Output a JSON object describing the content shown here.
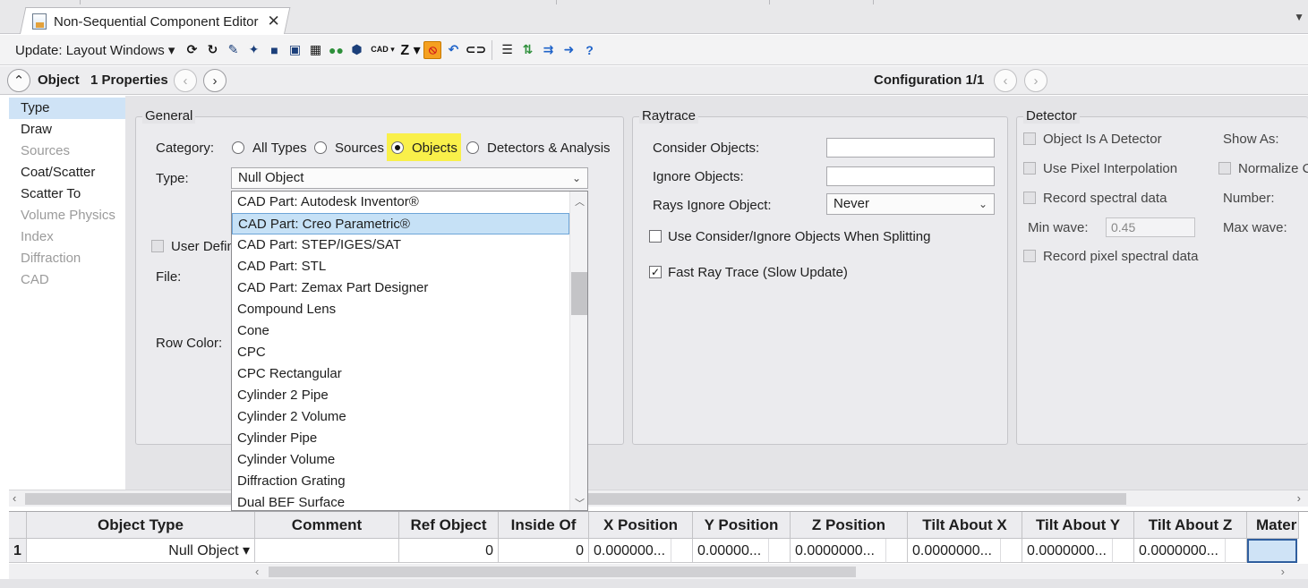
{
  "window": {
    "tab_title": "Non-Sequential Component Editor",
    "close_glyph": "✕"
  },
  "toolbar": {
    "update_label": "Update: Layout Windows ▾",
    "cad_label": "CAD ▾",
    "z_label": "Z ▾"
  },
  "nav": {
    "object_label": "Object",
    "properties_label": "1 Properties",
    "configuration_label": "Configuration 1/1"
  },
  "sidebar": {
    "items": [
      {
        "label": "Type",
        "state": "active"
      },
      {
        "label": "Draw",
        "state": "normal"
      },
      {
        "label": "Sources",
        "state": "disabled"
      },
      {
        "label": "Coat/Scatter",
        "state": "normal"
      },
      {
        "label": "Scatter To",
        "state": "normal"
      },
      {
        "label": "Volume Physics",
        "state": "disabled"
      },
      {
        "label": "Index",
        "state": "disabled"
      },
      {
        "label": "Diffraction",
        "state": "disabled"
      },
      {
        "label": "CAD",
        "state": "disabled"
      }
    ]
  },
  "general": {
    "title": "General",
    "category_label": "Category:",
    "category_options": [
      "All Types",
      "Sources",
      "Objects",
      "Detectors & Analysis"
    ],
    "category_selected": "Objects",
    "type_label": "Type:",
    "type_value": "Null Object",
    "user_defined_label": "User Defin",
    "file_label": "File:",
    "row_color_label": "Row Color:"
  },
  "type_dropdown": {
    "items": [
      "CAD Part: Autodesk Inventor®",
      "CAD Part: Creo Parametric®",
      "CAD Part: STEP/IGES/SAT",
      "CAD Part: STL",
      "CAD Part: Zemax Part Designer",
      "Compound Lens",
      "Cone",
      "CPC",
      "CPC Rectangular",
      "Cylinder 2 Pipe",
      "Cylinder 2 Volume",
      "Cylinder Pipe",
      "Cylinder Volume",
      "Diffraction Grating",
      "Dual BEF Surface"
    ],
    "highlighted": "CAD Part: Creo Parametric®"
  },
  "raytrace": {
    "title": "Raytrace",
    "consider_label": "Consider Objects:",
    "consider_value": "",
    "ignore_label": "Ignore Objects:",
    "ignore_value": "",
    "rays_ignore_label": "Rays Ignore Object:",
    "rays_ignore_value": "Never",
    "use_consider_label": "Use Consider/Ignore Objects When Splitting",
    "use_consider_checked": false,
    "fast_trace_label": "Fast Ray Trace (Slow Update)",
    "fast_trace_checked": true
  },
  "detector": {
    "title": "Detector",
    "is_detector_label": "Object Is A Detector",
    "pixel_interp_label": "Use Pixel Interpolation",
    "record_spectral_label": "Record spectral data",
    "min_wave_label": "Min wave:",
    "min_wave_value": "0.45",
    "record_pixel_label": "Record pixel spectral data",
    "show_as_label": "Show As:",
    "normalize_label": "Normalize C",
    "number_label": "Number:",
    "max_wave_label": "Max wave:"
  },
  "grid": {
    "columns": [
      "Object Type",
      "Comment",
      "Ref Object",
      "Inside Of",
      "X Position",
      "Y Position",
      "Z Position",
      "Tilt About X",
      "Tilt About Y",
      "Tilt About Z",
      "Mater"
    ],
    "row": {
      "index": "1",
      "object_type": "Null Object ▾",
      "comment": "",
      "ref_object": "0",
      "inside_of": "0",
      "x_position": "0.000000...",
      "y_position": "0.00000...",
      "z_position": "0.0000000...",
      "tilt_x": "0.0000000...",
      "tilt_y": "0.0000000...",
      "tilt_z": "0.0000000..."
    }
  },
  "colors": {
    "selection_highlight": "#f9f04a",
    "list_highlight": "#c6e1f6",
    "sidebar_active": "#cfe3f6"
  }
}
